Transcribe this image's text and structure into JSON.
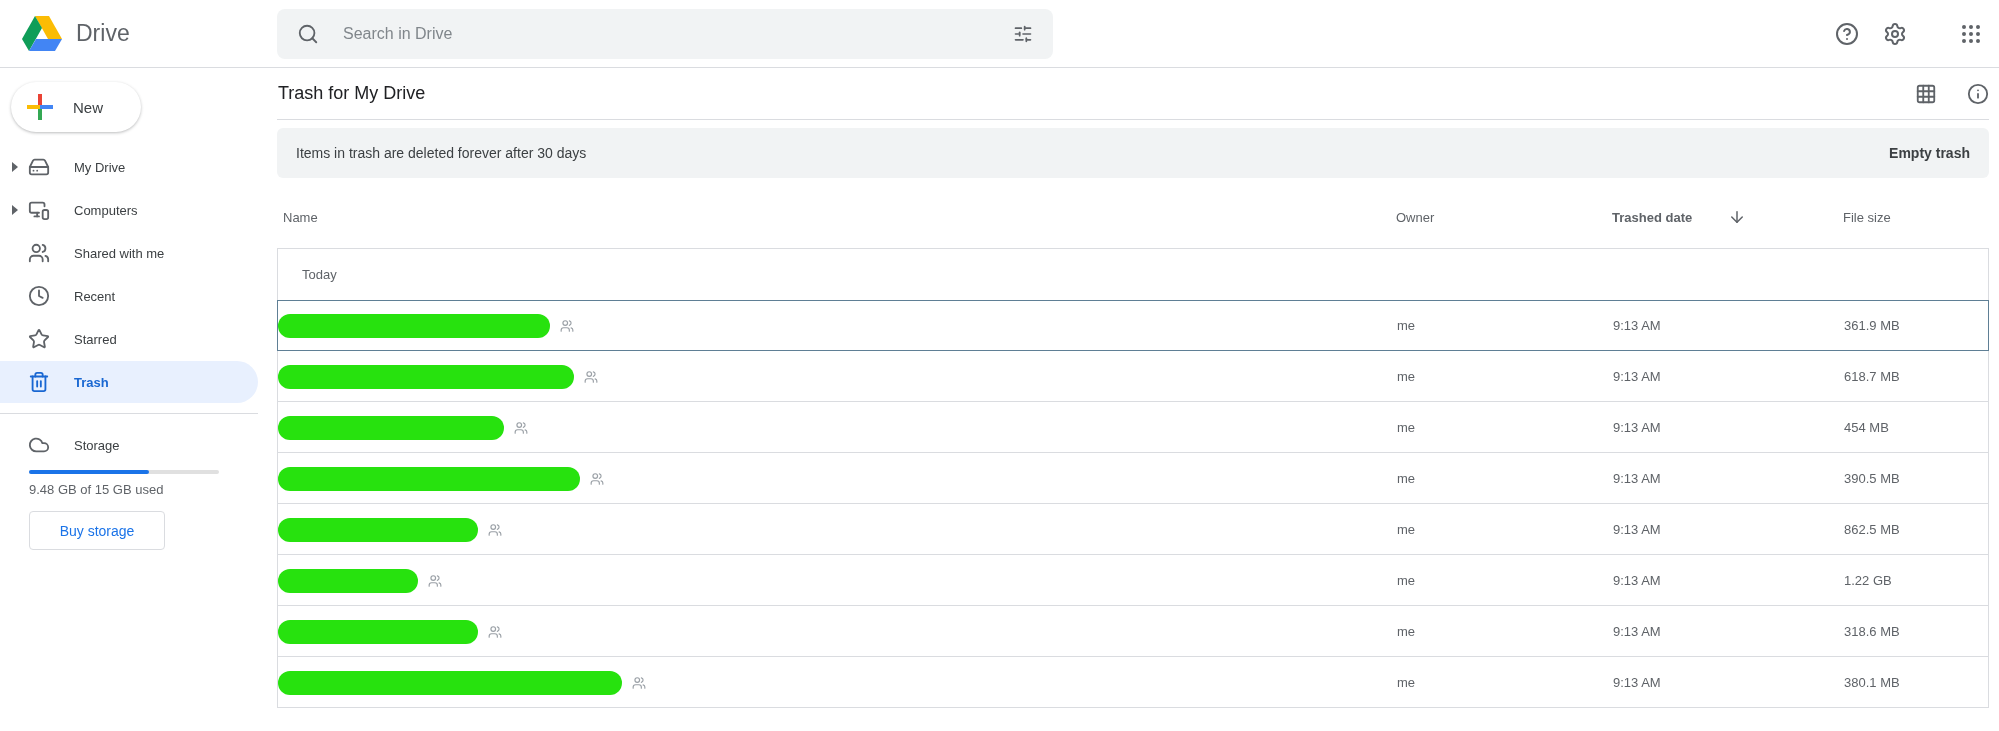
{
  "header": {
    "app_name": "Drive",
    "search": {
      "placeholder": "Search in Drive"
    }
  },
  "sidebar": {
    "new_button": "New",
    "items": [
      {
        "label": "My Drive",
        "kind": "drive",
        "expandable": true,
        "selected": false
      },
      {
        "label": "Computers",
        "kind": "computers",
        "expandable": true,
        "selected": false
      },
      {
        "label": "Shared with me",
        "kind": "shared",
        "expandable": false,
        "selected": false
      },
      {
        "label": "Recent",
        "kind": "recent",
        "expandable": false,
        "selected": false
      },
      {
        "label": "Starred",
        "kind": "starred",
        "expandable": false,
        "selected": false
      },
      {
        "label": "Trash",
        "kind": "trash",
        "expandable": false,
        "selected": true
      }
    ],
    "storage": {
      "label": "Storage",
      "level": 0.632,
      "usage": "9.48 GB of 15 GB used",
      "button": "Buy storage"
    }
  },
  "main": {
    "title": "Trash for My Drive",
    "banner": {
      "text": "Items in trash are deleted forever after 30 days",
      "action": "Empty trash"
    },
    "table": {
      "columns": [
        "Name",
        "Owner",
        "Trashed date",
        "File size"
      ],
      "group": "Today",
      "rows": [
        {
          "owner": "me",
          "trashed": "9:13 AM",
          "size": "361.9 MB",
          "selected": true
        },
        {
          "owner": "me",
          "trashed": "9:13 AM",
          "size": "618.7 MB",
          "selected": false
        },
        {
          "owner": "me",
          "trashed": "9:13 AM",
          "size": "454 MB",
          "selected": false
        },
        {
          "owner": "me",
          "trashed": "9:13 AM",
          "size": "390.5 MB",
          "selected": false
        },
        {
          "owner": "me",
          "trashed": "9:13 AM",
          "size": "862.5 MB",
          "selected": false
        },
        {
          "owner": "me",
          "trashed": "9:13 AM",
          "size": "1.22 GB",
          "selected": false
        },
        {
          "owner": "me",
          "trashed": "9:13 AM",
          "size": "318.6 MB",
          "selected": false
        },
        {
          "owner": "me",
          "trashed": "9:13 AM",
          "size": "380.1 MB",
          "selected": false
        }
      ]
    }
  }
}
